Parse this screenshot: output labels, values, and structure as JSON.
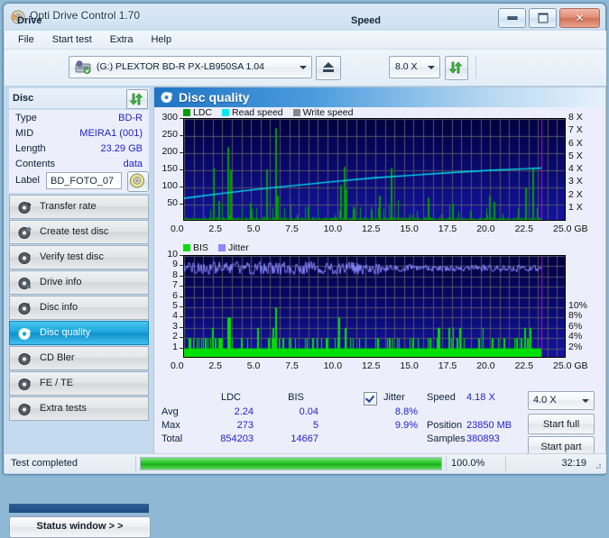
{
  "window": {
    "title": "Opti Drive Control 1.70",
    "icon": "disc-icon",
    "buttons": {
      "minimize": "minimize",
      "maximize": "maximize",
      "close": "close"
    }
  },
  "menu": {
    "items": [
      "File",
      "Start test",
      "Extra",
      "Help"
    ]
  },
  "toolbar": {
    "drive_label": "Drive",
    "drive_value": "(G:)  PLEXTOR BD-R  PX-LB950SA 1.04",
    "eject_label": "eject",
    "speed_label": "Speed",
    "speed_value": "8.0 X",
    "refresh_label": "refresh"
  },
  "disc": {
    "header": "Disc",
    "rows": [
      {
        "key": "Type",
        "value": "BD-R"
      },
      {
        "key": "MID",
        "value": "MEIRA1 (001)"
      },
      {
        "key": "Length",
        "value": "23.29 GB"
      },
      {
        "key": "Contents",
        "value": "data"
      }
    ],
    "label_key": "Label",
    "label_value": "BD_FOTO_07"
  },
  "nav": {
    "items": [
      {
        "label": "Transfer rate",
        "selected": false
      },
      {
        "label": "Create test disc",
        "selected": false
      },
      {
        "label": "Verify test disc",
        "selected": false
      },
      {
        "label": "Drive info",
        "selected": false
      },
      {
        "label": "Disc info",
        "selected": false
      },
      {
        "label": "Disc quality",
        "selected": true
      },
      {
        "label": "CD Bler",
        "selected": false
      },
      {
        "label": "FE / TE",
        "selected": false
      },
      {
        "label": "Extra tests",
        "selected": false
      }
    ],
    "status_window_label": "Status window > >"
  },
  "main": {
    "title": "Disc quality",
    "stats": {
      "col_headers": [
        "LDC",
        "BIS"
      ],
      "row_headers": [
        "Avg",
        "Max",
        "Total"
      ],
      "ldc": {
        "avg": "2.24",
        "max": "273",
        "total": "854203"
      },
      "bis": {
        "avg": "0.04",
        "max": "5",
        "total": "14667"
      },
      "jitter_label": "Jitter",
      "jitter_checked": true,
      "jitter_avg": "8.8%",
      "jitter_max": "9.9%",
      "speed_label": "Speed",
      "speed_value": "4.18 X",
      "position_label": "Position",
      "position_value": "23850 MB",
      "samples_label": "Samples",
      "samples_value": "380893",
      "rate_select": "4.0 X",
      "start_full": "Start full",
      "start_part": "Start part"
    }
  },
  "statusbar": {
    "message": "Test completed",
    "percent_text": "100.0%",
    "percent_value": 100,
    "elapsed": "32:19"
  },
  "colors": {
    "ldc": "#00a000",
    "read_speed": "#00e8f0",
    "write_speed": "#888888",
    "bis": "#00e000",
    "jitter": "#8888ff",
    "plot_bg": "#00005c",
    "grid": "#555566",
    "marker": "#d000d0",
    "accent": "#2222cc"
  },
  "chart_data": [
    {
      "type": "line",
      "name": "quality-top-chart",
      "title": "LDC / Read speed / Write speed",
      "legend": [
        {
          "label": "LDC",
          "color": "#00a000"
        },
        {
          "label": "Read speed",
          "color": "#00e8f0"
        },
        {
          "label": "Write speed",
          "color": "#888888"
        }
      ],
      "legend_position": "top-left",
      "grid": true,
      "xlabel": "GB",
      "x_ticks": [
        "0.0",
        "2.5",
        "5.0",
        "7.5",
        "10.0",
        "12.5",
        "15.0",
        "17.5",
        "20.0",
        "22.5",
        "25.0"
      ],
      "xlim": [
        0,
        25
      ],
      "ylabel": "LDC",
      "y_ticks": [
        50,
        100,
        150,
        200,
        250,
        300
      ],
      "ylim": [
        0,
        300
      ],
      "y2label": "Speed",
      "y2_ticks": [
        "1 X",
        "2 X",
        "3 X",
        "4 X",
        "5 X",
        "6 X",
        "7 X",
        "8 X"
      ],
      "y2lim": [
        0,
        8
      ],
      "data_end_gb": 23.35,
      "marker_gb": 23.35,
      "series": [
        {
          "name": "Read speed",
          "color": "#00e8f0",
          "axis": "y2",
          "x": [
            0.0,
            2.5,
            5.0,
            7.5,
            10.0,
            12.5,
            15.0,
            17.5,
            20.0,
            22.5,
            23.35
          ],
          "values": [
            1.82,
            2.2,
            2.55,
            2.85,
            3.15,
            3.42,
            3.62,
            3.82,
            4.0,
            4.13,
            4.18
          ]
        },
        {
          "name": "LDC",
          "color": "#00a000",
          "axis": "y",
          "baseline": 12,
          "peaks": [
            [
              1.9,
              157
            ],
            [
              2.25,
              60
            ],
            [
              2.85,
              218
            ],
            [
              3.0,
              152
            ],
            [
              4.3,
              55
            ],
            [
              5.35,
              153
            ],
            [
              5.95,
              273
            ],
            [
              6.1,
              75
            ],
            [
              8.1,
              45
            ],
            [
              10.2,
              107
            ],
            [
              10.45,
              160
            ],
            [
              10.55,
              95
            ],
            [
              12.75,
              75
            ],
            [
              13.5,
              157
            ],
            [
              15.9,
              70
            ],
            [
              17.5,
              52
            ],
            [
              19.95,
              75
            ],
            [
              20.2,
              58
            ],
            [
              22.3,
              100
            ],
            [
              22.75,
              158
            ]
          ]
        }
      ]
    },
    {
      "type": "line",
      "name": "quality-bottom-chart",
      "title": "BIS / Jitter",
      "legend": [
        {
          "label": "BIS",
          "color": "#00e000"
        },
        {
          "label": "Jitter",
          "color": "#8888ff"
        }
      ],
      "legend_position": "top-left",
      "grid": true,
      "xlabel": "GB",
      "x_ticks": [
        "0.0",
        "2.5",
        "5.0",
        "7.5",
        "10.0",
        "12.5",
        "15.0",
        "17.5",
        "20.0",
        "22.5",
        "25.0"
      ],
      "xlim": [
        0,
        25
      ],
      "ylabel": "BIS",
      "y_ticks": [
        1,
        2,
        3,
        4,
        5,
        6,
        7,
        8,
        9,
        10
      ],
      "ylim": [
        0,
        10
      ],
      "y2label": "Jitter",
      "y2_ticks": [
        "2%",
        "4%",
        "6%",
        "8%",
        "10%"
      ],
      "y2lim": [
        0,
        10
      ],
      "data_end_gb": 23.35,
      "marker_gb": 23.35,
      "series": [
        {
          "name": "Jitter",
          "color": "#8888ff",
          "axis": "y2",
          "mean_percent": 8.8,
          "max_percent": 9.9,
          "min_percent": 8.2
        },
        {
          "name": "BIS",
          "color": "#00e000",
          "axis": "y",
          "baseline": 1,
          "peaks": [
            [
              1.85,
              3
            ],
            [
              2.0,
              2
            ],
            [
              2.3,
              2
            ],
            [
              2.85,
              4
            ],
            [
              2.95,
              4
            ],
            [
              3.7,
              2
            ],
            [
              4.8,
              3
            ],
            [
              5.75,
              3
            ],
            [
              5.95,
              5
            ],
            [
              6.4,
              2
            ],
            [
              8.4,
              2
            ],
            [
              9.3,
              2
            ],
            [
              10.1,
              4
            ],
            [
              10.5,
              3
            ],
            [
              12.6,
              2
            ],
            [
              13.4,
              2
            ],
            [
              14.9,
              2
            ],
            [
              16.6,
              3
            ],
            [
              17.3,
              3
            ],
            [
              18.0,
              3
            ],
            [
              20.1,
              2
            ],
            [
              22.2,
              3
            ],
            [
              22.6,
              3
            ]
          ]
        }
      ]
    }
  ]
}
